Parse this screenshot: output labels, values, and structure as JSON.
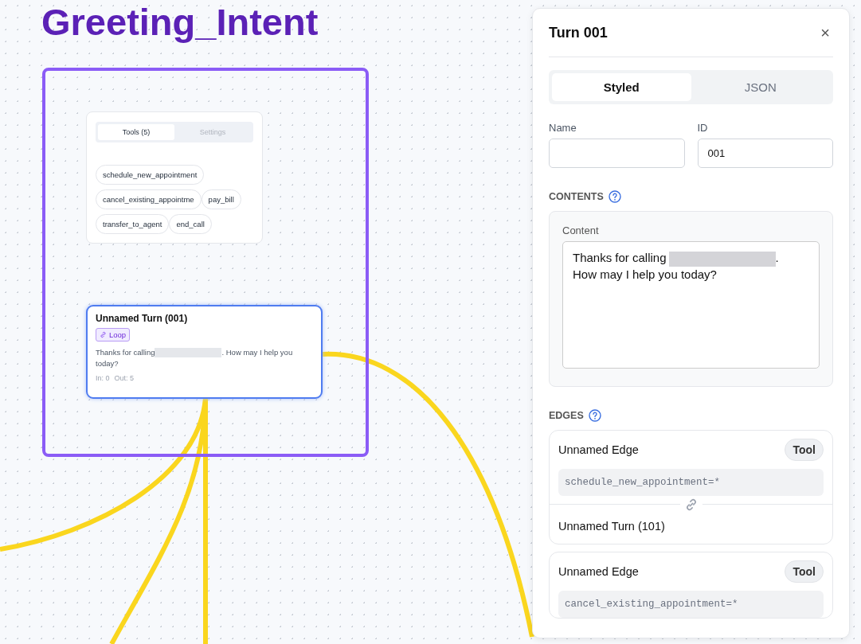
{
  "title": "Greeting_Intent",
  "tools_card": {
    "tabs": [
      {
        "label": "Tools (5)",
        "selected": true
      },
      {
        "label": "Settings",
        "selected": false
      }
    ],
    "tools": [
      "schedule_new_appointment",
      "cancel_existing_appointme",
      "pay_bill",
      "transfer_to_agent",
      "end_call"
    ]
  },
  "node": {
    "title": "Unnamed Turn (001)",
    "badge": "Loop",
    "text_before": "Thanks for calling",
    "text_after": ". How may I help you",
    "text_end": "today?",
    "stats": [
      "In: 0",
      "Out: 5"
    ]
  },
  "panel": {
    "title": "Turn 001",
    "close": "×",
    "tabs": [
      {
        "label": "Styled",
        "selected": true
      },
      {
        "label": "JSON",
        "selected": false
      }
    ],
    "fields": [
      {
        "label": "Name"
      },
      {
        "label": "ID",
        "value": "001"
      }
    ],
    "contents": {
      "heading": "CONTENTS",
      "field_label": "Content",
      "text_before": "Thanks for calling",
      "text_after": ".",
      "second_line": "How may I help you today?"
    },
    "edges": {
      "heading": "EDGES",
      "items": [
        {
          "title": "Unnamed Edge",
          "tag": "Tool",
          "condition": "schedule_new_appointment=*",
          "target": "Unnamed Turn (101)"
        },
        {
          "title": "Unnamed Edge",
          "tag": "Tool",
          "condition": "cancel_existing_appointment=*"
        }
      ]
    }
  }
}
